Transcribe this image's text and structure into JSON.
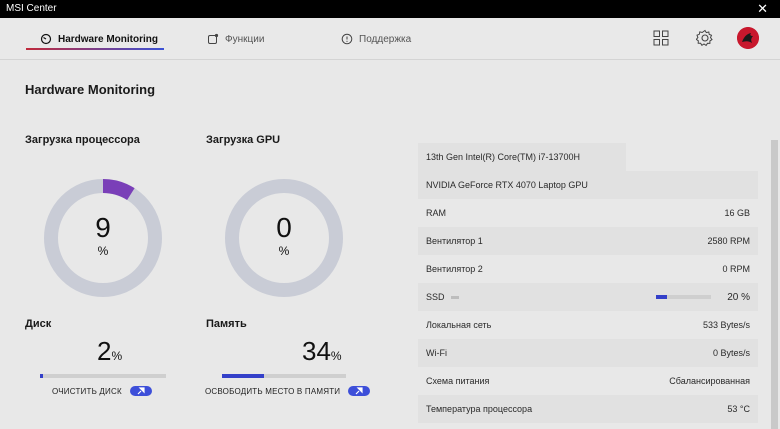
{
  "window": {
    "title": "MSI Center",
    "close_glyph": "✕"
  },
  "tabs": [
    {
      "label": "Hardware Monitoring",
      "icon": "dial-icon"
    },
    {
      "label": "Функции",
      "icon": "features-icon"
    },
    {
      "label": "Поддержка",
      "icon": "support-icon"
    }
  ],
  "header_icons": [
    "grid-icon",
    "gear-icon",
    "avatar"
  ],
  "page_title": "Hardware Monitoring",
  "cpu": {
    "label": "Загрузка процессора",
    "value": "9",
    "unit": "%",
    "percent": 9
  },
  "gpu": {
    "label": "Загрузка GPU",
    "value": "0",
    "unit": "%",
    "percent": 0
  },
  "disk": {
    "label": "Диск",
    "value": "2",
    "unit": "%",
    "percent": 2,
    "action": "ОЧИСТИТЬ ДИСК"
  },
  "memory": {
    "label": "Память",
    "value": "34",
    "unit": "%",
    "percent": 34,
    "action": "ОСВОБОДИТЬ МЕСТО В ПАМЯТИ"
  },
  "info": {
    "cpu_name": "13th Gen Intel(R) Core(TM) i7-13700H",
    "gpu_name": "NVIDIA GeForce RTX 4070 Laptop GPU",
    "rows": [
      {
        "label": "RAM",
        "value": "16 GB"
      },
      {
        "label": "Вентилятор 1",
        "value": "2580 RPM"
      },
      {
        "label": "Вентилятор 2",
        "value": "0 RPM"
      },
      {
        "label": "SSD",
        "value": "20 %",
        "percent": 20
      },
      {
        "label": "Локальная сеть",
        "value": "533 Bytes/s"
      },
      {
        "label": "Wi-Fi",
        "value": "0 Bytes/s"
      },
      {
        "label": "Схема питания",
        "value": "Сбалансированная"
      },
      {
        "label": "Температура процессора",
        "value": "53 °C"
      }
    ]
  },
  "colors": {
    "accent_blue": "#3440c9",
    "gauge_purple": "#7a3fb8",
    "gauge_track": "#c9ccd6"
  }
}
